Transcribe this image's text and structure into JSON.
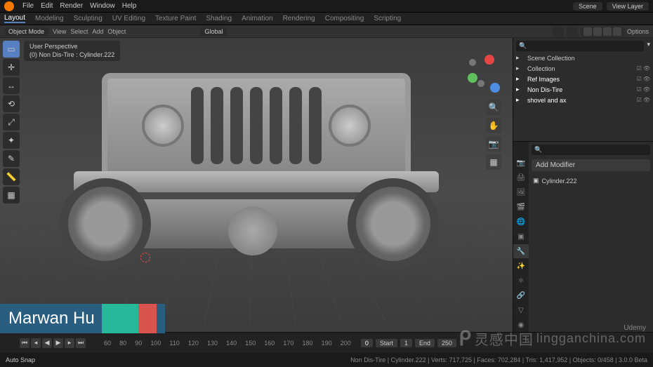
{
  "top_menu": {
    "items": [
      "File",
      "Edit",
      "Render",
      "Window",
      "Help"
    ]
  },
  "top_right": {
    "scene": "Scene",
    "layer": "View Layer"
  },
  "workspaces": [
    "Layout",
    "Modeling",
    "Sculpting",
    "UV Editing",
    "Texture Paint",
    "Shading",
    "Animation",
    "Rendering",
    "Compositing",
    "Scripting"
  ],
  "active_workspace": "Layout",
  "header": {
    "mode": "Object Mode",
    "menus": [
      "View",
      "Select",
      "Add",
      "Object"
    ],
    "orientation": "Global",
    "options_label": "Options"
  },
  "viewport_info": {
    "line1": "User Perspective",
    "line2": "(0) Non Dis-Tire : Cylinder.222"
  },
  "outliner": {
    "scene_label": "Scene Collection",
    "items": [
      {
        "name": "Collection",
        "icon": "📦"
      },
      {
        "name": "Ref Images",
        "icon": "📦"
      },
      {
        "name": "Non Dis-Tire",
        "icon": "📦",
        "active": true
      },
      {
        "name": "shovel and ax",
        "icon": "📦"
      }
    ]
  },
  "properties": {
    "add_modifier": "Add Modifier",
    "object_name": "Cylinder.222"
  },
  "timeline": {
    "frames": [
      "60",
      "80",
      "90",
      "100",
      "110",
      "120",
      "130",
      "140",
      "150",
      "160",
      "170",
      "180",
      "190",
      "200"
    ],
    "current": "0",
    "start_label": "Start",
    "start": "1",
    "end_label": "End",
    "end": "250"
  },
  "status": {
    "left": "Auto Snap",
    "stats": "Non Dis-Tire | Cylinder.222 | Verts: 717,725 | Faces: 702,284 | Tris: 1,417,952 | Objects: 0/458 | 3.0.0 Beta"
  },
  "banner": {
    "name": "Marwan Hu"
  },
  "watermark": {
    "cn": "灵感中国",
    "en": "lingganchina.com"
  },
  "udemy": "Udemy"
}
